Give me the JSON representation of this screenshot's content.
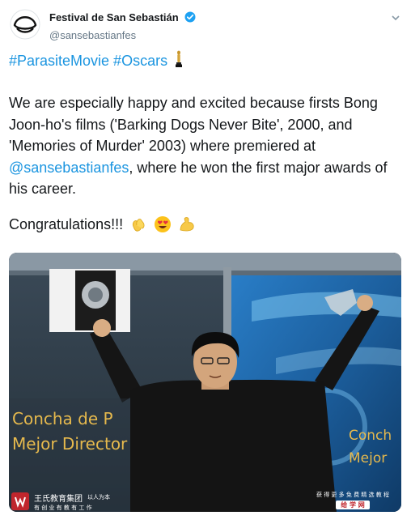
{
  "account": {
    "display_name": "Festival de San Sebastián",
    "handle": "@sansebastianfes",
    "verified_icon": "verified-badge-icon",
    "menu_icon": "chevron-down-icon"
  },
  "tweet": {
    "hashtags": "#ParasiteMovie #Oscars",
    "text_part1": "We are especially happy and excited because firsts Bong Joon-ho's films ('Barking Dogs Never Bite', 2000, and 'Memories of Murder' 2003) where premiered at ",
    "mention": "@sansebastianfes",
    "text_part2": ", where he won the first major awards of his career.",
    "congrats": "Congratulations!!!",
    "emojis": [
      "clapping-hands-icon",
      "heart-eyes-icon",
      "flexed-biceps-icon"
    ]
  },
  "photo": {
    "sign_line1": "Concha de P",
    "sign_line2": "Mejor Director",
    "sign_right1": "Conch",
    "sign_right2": "Mejor"
  },
  "watermark": {
    "left_main": "王氏教育集团",
    "left_tag": "以人为本",
    "left_sub": "有 创 业 有 教 有 工 作",
    "right_line1": "获 得 更 多 免 费 精 选 教 程",
    "right_badge": "给 学 网"
  },
  "colors": {
    "link": "#1b95e0",
    "verified": "#1da1f2",
    "text": "#14171a",
    "muted": "#657786"
  }
}
